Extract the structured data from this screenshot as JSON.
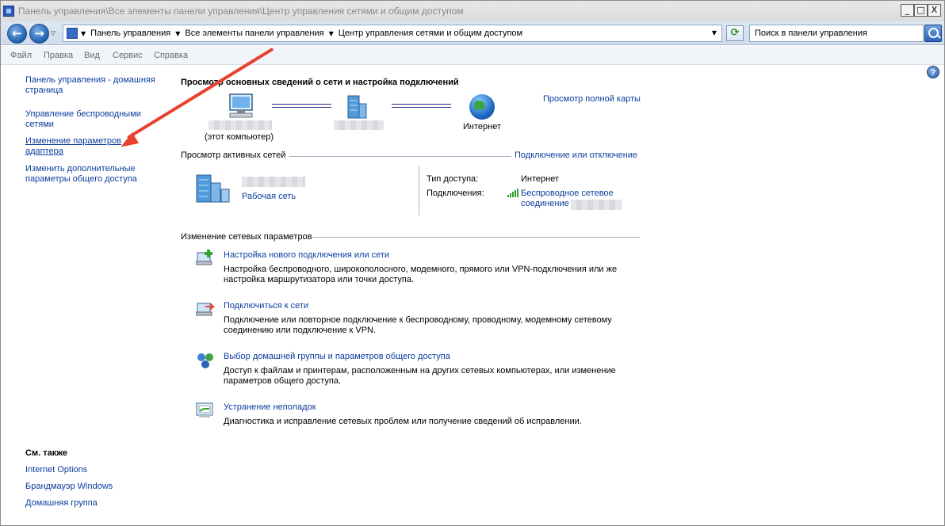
{
  "window": {
    "title": "Панель управления\\Все элементы панели управления\\Центр управления сетями и общим доступом",
    "minimize": "_",
    "maximize": "□",
    "close": "X"
  },
  "address": {
    "crumbs": [
      "Панель управления",
      "Все элементы панели управления",
      "Центр управления сетями и общим доступом"
    ],
    "search_placeholder": "Поиск в панели управления"
  },
  "menu": [
    "Файл",
    "Правка",
    "Вид",
    "Сервис",
    "Справка"
  ],
  "sidebar": {
    "home": "Панель управления - домашняя страница",
    "wireless": "Управление беспроводными сетями",
    "adapter": "Изменение параметров адаптера",
    "sharing": "Изменить дополнительные параметры общего доступа",
    "see_also_title": "См. также",
    "see_also": [
      "Internet Options",
      "Брандмауэр Windows",
      "Домашняя группа"
    ]
  },
  "main": {
    "heading": "Просмотр основных сведений о сети и настройка подключений",
    "full_map": "Просмотр полной карты",
    "this_computer": "(этот компьютер)",
    "internet": "Интернет",
    "active_networks": "Просмотр активных сетей",
    "connect_disconnect": "Подключение или отключение",
    "network_type": "Рабочая сеть",
    "access_type_label": "Тип доступа:",
    "access_type_value": "Интернет",
    "connections_label": "Подключения:",
    "connection_value": "Беспроводное сетевое соединение",
    "change_settings": "Изменение сетевых параметров",
    "tasks": [
      {
        "title": "Настройка нового подключения или сети",
        "desc": "Настройка беспроводного, широкополосного, модемного, прямого или VPN-подключения или же настройка маршрутизатора или точки доступа."
      },
      {
        "title": "Подключиться к сети",
        "desc": "Подключение или повторное подключение к беспроводному, проводному, модемному сетевому соединению или подключение к VPN."
      },
      {
        "title": "Выбор домашней группы и параметров общего доступа",
        "desc": "Доступ к файлам и принтерам, расположенным на других сетевых компьютерах, или изменение параметров общего доступа."
      },
      {
        "title": "Устранение неполадок",
        "desc": "Диагностика и исправление сетевых проблем или получение сведений об исправлении."
      }
    ]
  },
  "colors": {
    "link": "#0c3c9e",
    "arrow": "#e8412f"
  }
}
